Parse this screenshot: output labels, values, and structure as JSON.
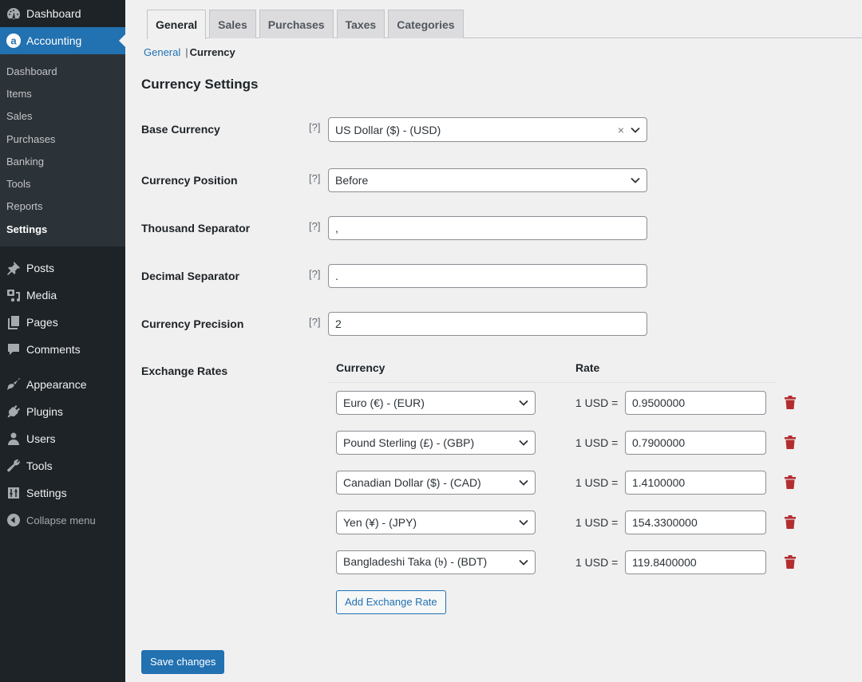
{
  "sidebar": {
    "dashboard": {
      "label": "Dashboard",
      "icon": "dashboard-gauge-icon"
    },
    "accounting": {
      "label": "Accounting",
      "icon": "accounting-logo-icon",
      "submenu": [
        {
          "label": "Dashboard"
        },
        {
          "label": "Items"
        },
        {
          "label": "Sales"
        },
        {
          "label": "Purchases"
        },
        {
          "label": "Banking"
        },
        {
          "label": "Tools"
        },
        {
          "label": "Reports"
        },
        {
          "label": "Settings",
          "active": true
        }
      ]
    },
    "items": [
      {
        "label": "Posts",
        "icon": "pushpin-icon"
      },
      {
        "label": "Media",
        "icon": "media-icon"
      },
      {
        "label": "Pages",
        "icon": "pages-icon"
      },
      {
        "label": "Comments",
        "icon": "comment-icon"
      },
      {
        "label": "Appearance",
        "icon": "paintbrush-icon"
      },
      {
        "label": "Plugins",
        "icon": "plugin-icon"
      },
      {
        "label": "Users",
        "icon": "user-icon"
      },
      {
        "label": "Tools",
        "icon": "wrench-icon"
      },
      {
        "label": "Settings",
        "icon": "settings-sliders-icon"
      }
    ],
    "collapse": {
      "label": "Collapse menu",
      "icon": "collapse-arrow-icon"
    }
  },
  "tabs": [
    {
      "label": "General",
      "active": true
    },
    {
      "label": "Sales"
    },
    {
      "label": "Purchases"
    },
    {
      "label": "Taxes"
    },
    {
      "label": "Categories"
    }
  ],
  "subnav": {
    "link": "General",
    "separator": "|",
    "current": "Currency"
  },
  "page_title": "Currency Settings",
  "help_marker": "[?]",
  "fields": {
    "base_currency": {
      "label": "Base Currency",
      "value": "US Dollar ($) - (USD)",
      "clear": "×"
    },
    "currency_position": {
      "label": "Currency Position",
      "value": "Before"
    },
    "thousand_separator": {
      "label": "Thousand Separator",
      "value": ","
    },
    "decimal_separator": {
      "label": "Decimal Separator",
      "value": "."
    },
    "currency_precision": {
      "label": "Currency Precision",
      "value": "2"
    }
  },
  "exchange_rates": {
    "label": "Exchange Rates",
    "col_currency": "Currency",
    "col_rate": "Rate",
    "rows": [
      {
        "currency": "Euro (€) - (EUR)",
        "prefix": "1 USD =",
        "rate": "0.9500000"
      },
      {
        "currency": "Pound Sterling (£) - (GBP)",
        "prefix": "1 USD =",
        "rate": "0.7900000"
      },
      {
        "currency": "Canadian Dollar ($) - (CAD)",
        "prefix": "1 USD =",
        "rate": "1.4100000"
      },
      {
        "currency": "Yen (¥) - (JPY)",
        "prefix": "1 USD =",
        "rate": "154.3300000"
      },
      {
        "currency": "Bangladeshi Taka (৳) - (BDT)",
        "prefix": "1 USD =",
        "rate": "119.8400000"
      }
    ],
    "add_button": "Add Exchange Rate",
    "delete_color": "#b32d2e"
  },
  "save_button": "Save changes",
  "colors": {
    "accent": "#2271b1",
    "sidebar_bg": "#1d2327",
    "submenu_bg": "#2c3338"
  }
}
